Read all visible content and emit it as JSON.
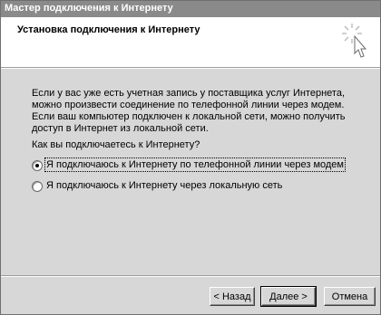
{
  "window": {
    "title": "Мастер подключения к Интернету"
  },
  "header": {
    "title": "Установка подключения к Интернету",
    "icon": "wizard-wand-icon"
  },
  "body": {
    "description": "Если у вас уже есть учетная запись у поставщика услуг Интернета, можно произвести соединение по телефонной линии через модем. Если ваш компьютер подключен к локальной сети, можно получить доступ в Интернет из локальной сети.",
    "question": "Как вы подключаетесь к Интернету?",
    "options": [
      {
        "label": "Я подключаюсь к Интернету по телефонной линии через модем",
        "selected": true
      },
      {
        "label": "Я подключаюсь к Интернету через локальную сеть",
        "selected": false
      }
    ]
  },
  "buttons": {
    "back": "< Назад",
    "next": "Далее >",
    "cancel": "Отмена"
  }
}
